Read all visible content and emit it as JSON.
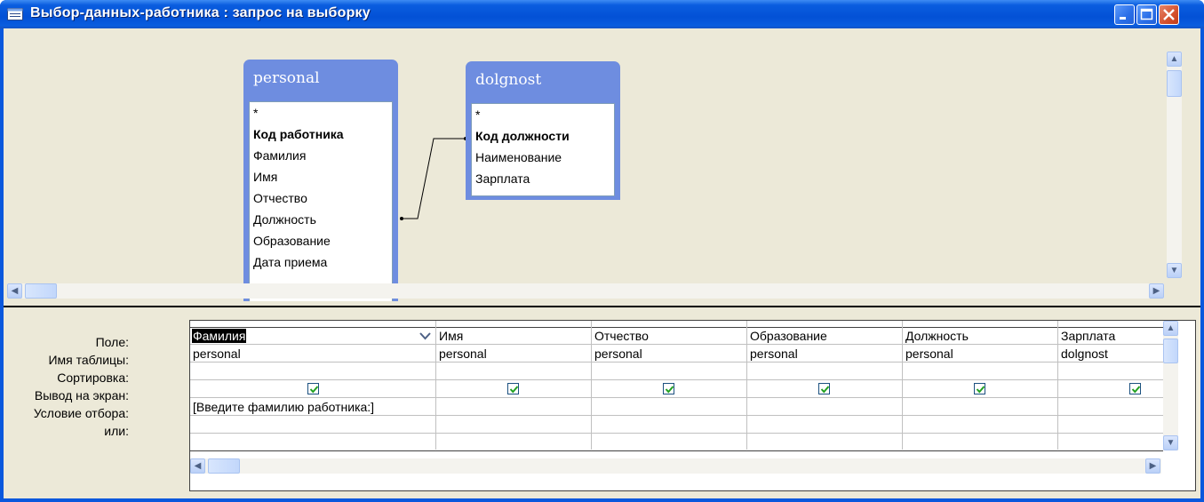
{
  "window": {
    "title": "Выбор-данных-работника : запрос на выборку"
  },
  "tables": [
    {
      "name": "personal",
      "fields": [
        "*",
        "Код работника",
        "Фамилия",
        "Имя",
        "Отчество",
        "Должность",
        "Образование",
        "Дата приема"
      ],
      "key_field": "Код работника"
    },
    {
      "name": "dolgnost",
      "fields": [
        "*",
        "Код должности",
        "Наименование",
        "Зарплата"
      ],
      "key_field": "Код должности"
    }
  ],
  "relationship": {
    "from": "personal.Должность",
    "to": "dolgnost.Код должности"
  },
  "grid": {
    "row_labels": [
      "Поле:",
      "Имя таблицы:",
      "Сортировка:",
      "Вывод на экран:",
      "Условие отбора:",
      "или:"
    ],
    "columns": [
      {
        "field": "Фамилия",
        "table": "personal",
        "sort": "",
        "show": true,
        "criteria": "[Введите фамилию работника:]",
        "or": ""
      },
      {
        "field": "Имя",
        "table": "personal",
        "sort": "",
        "show": true,
        "criteria": "",
        "or": ""
      },
      {
        "field": "Отчество",
        "table": "personal",
        "sort": "",
        "show": true,
        "criteria": "",
        "or": ""
      },
      {
        "field": "Образование",
        "table": "personal",
        "sort": "",
        "show": true,
        "criteria": "",
        "or": ""
      },
      {
        "field": "Должность",
        "table": "personal",
        "sort": "",
        "show": true,
        "criteria": "",
        "or": ""
      },
      {
        "field": "Зарплата",
        "table": "dolgnost",
        "sort": "",
        "show": true,
        "criteria": "",
        "or": ""
      }
    ]
  }
}
